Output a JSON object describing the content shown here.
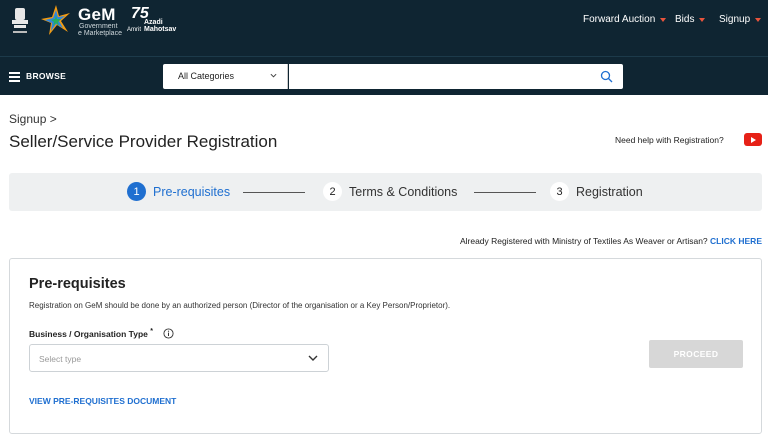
{
  "header": {
    "gem_title": "GeM",
    "gem_subtitle_1": "Government",
    "gem_subtitle_2": "e Marketplace",
    "azadi_number": "75",
    "azadi_line_1": "Azadi",
    "azadi_line_2": "Amrit",
    "azadi_line_3": "Mahotsav",
    "nav": [
      {
        "label": "Forward Auction"
      },
      {
        "label": "Bids"
      },
      {
        "label": "Signup"
      }
    ]
  },
  "browse_bar": {
    "browse_label": "BROWSE",
    "category_selected": "All Categories",
    "search_placeholder": ""
  },
  "page": {
    "breadcrumb": "Signup >",
    "title": "Seller/Service Provider Registration",
    "help_text": "Need help with Registration?"
  },
  "stepper": {
    "steps": [
      {
        "number": "1",
        "label": "Pre-requisites",
        "active": true
      },
      {
        "number": "2",
        "label": "Terms & Conditions",
        "active": false
      },
      {
        "number": "3",
        "label": "Registration",
        "active": false
      }
    ]
  },
  "textiles": {
    "text": "Already Registered with Ministry of Textiles As Weaver or Artisan?",
    "link": "CLICK HERE"
  },
  "prerequisites": {
    "title": "Pre-requisites",
    "description": "Registration on GeM should be done by an authorized person (Director of the organisation or a Key Person/Proprietor).",
    "field_label": "Business / Organisation Type",
    "required_mark": "*",
    "select_placeholder": "Select type",
    "proceed_label": "PROCEED",
    "doc_link": "VIEW PRE-REQUISITES DOCUMENT"
  },
  "colors": {
    "header_bg": "#0f2532",
    "accent_blue": "#1f6fd0",
    "caret_red": "#e8543c",
    "youtube_red": "#e62117",
    "disabled_button": "#d7d7d7"
  },
  "icons": [
    "national-emblem-icon",
    "gem-star-logo-icon",
    "hamburger-icon",
    "chevron-down-icon",
    "search-icon",
    "youtube-icon",
    "info-icon"
  ]
}
